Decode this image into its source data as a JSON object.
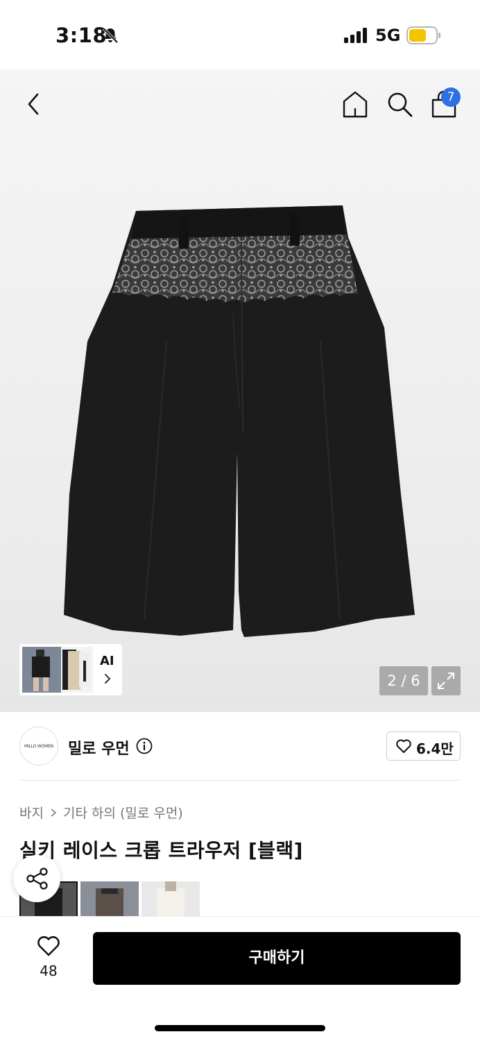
{
  "status": {
    "time": "3:18",
    "network": "5G",
    "battery_color": "#f5c400"
  },
  "nav": {
    "cart_count": "7"
  },
  "gallery": {
    "page_indicator": "2 / 6",
    "ai_label": "AI",
    "product_color": "#1c1c1c",
    "lace_color": "#8a8a8a"
  },
  "brand": {
    "logo_text": "MILLO WOMEN",
    "name": "밀로 우먼",
    "likes": "6.4만"
  },
  "product": {
    "breadcrumb": [
      "바지",
      "기타 하의 (밀로 우먼)"
    ],
    "title": "실키 레이스 크롭 트라우저 [블랙]"
  },
  "bottom": {
    "wish_count": "48",
    "buy_label": "구매하기"
  },
  "colors": {
    "accent_badge": "#2f6fe4"
  }
}
